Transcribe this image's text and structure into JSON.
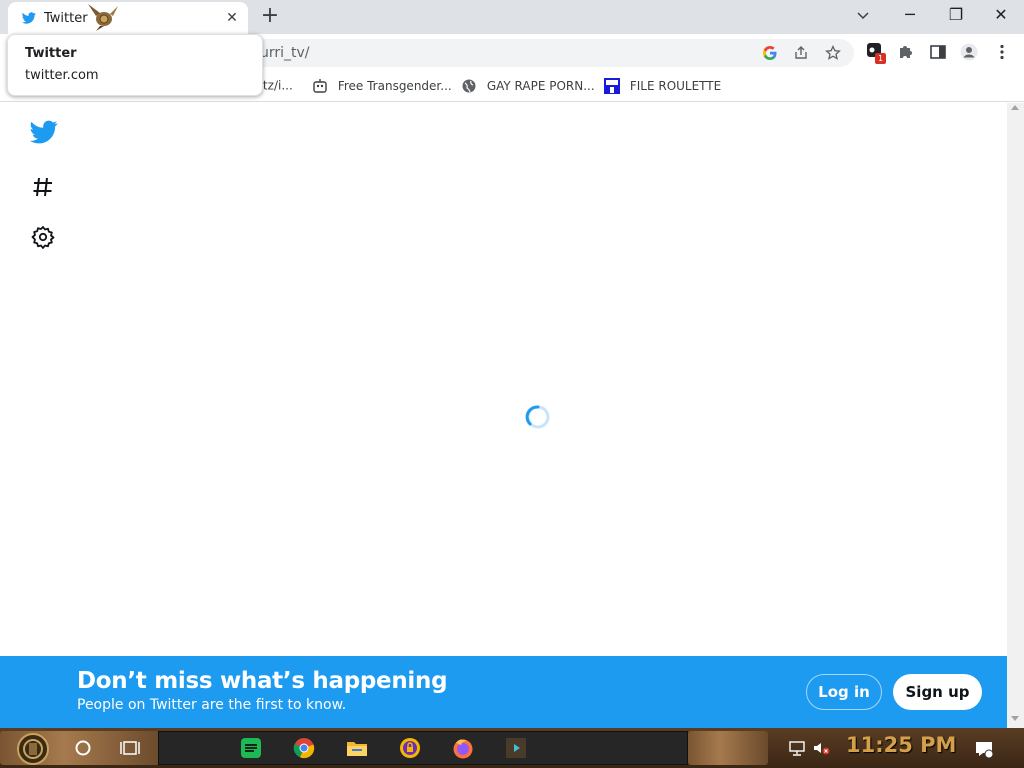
{
  "browser": {
    "tab": {
      "title": "Twitter",
      "close": "✕"
    },
    "new_tab": "+",
    "window": {
      "minimize": "─",
      "restore": "❐",
      "close": "✕"
    },
    "address": {
      "url_visible": "urri_tv/"
    },
    "extension_badge": "1",
    "tooltip": {
      "title": "Twitter",
      "domain": "twitter.com"
    },
    "bookmarks": [
      {
        "label": "rtz/i...",
        "icon": "partial"
      },
      {
        "label": "Free Transgender...",
        "icon": "robot-icon"
      },
      {
        "label": "GAY RAPE PORN...",
        "icon": "globe-icon"
      },
      {
        "label": "FILE ROULETTE",
        "icon": "mft-icon"
      }
    ]
  },
  "page": {
    "sidebar_icons": [
      "twitter-bird-icon",
      "hashtag-icon",
      "settings-gear-icon"
    ],
    "banner": {
      "title": "Don’t miss what’s happening",
      "subtitle": "People on Twitter are the first to know.",
      "login": "Log in",
      "signup": "Sign up"
    }
  },
  "colors": {
    "twitter_blue": "#1d9bf0",
    "chrome_tabstrip": "#dee1e6"
  },
  "taskbar": {
    "clock": "11:25 PM",
    "apps": [
      "spotify-icon",
      "chrome-icon",
      "file-explorer-icon",
      "vpn-icon",
      "firefox-icon",
      "media-player-icon"
    ]
  }
}
